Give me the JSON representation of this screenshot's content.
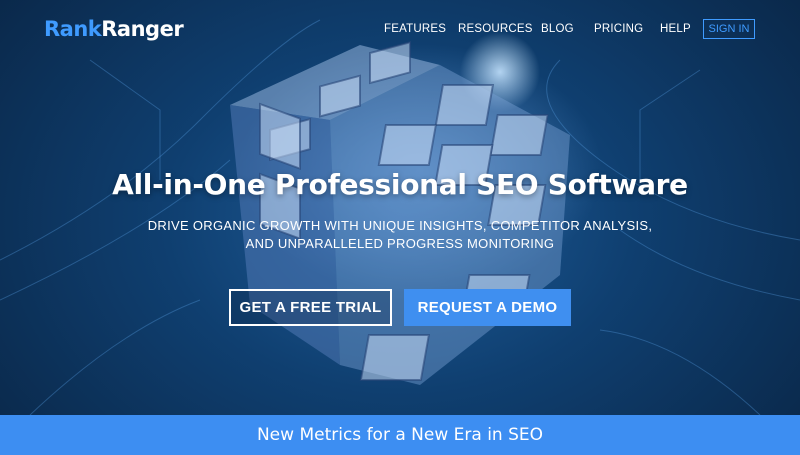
{
  "brand": {
    "part1": "Rank",
    "part2": "Ranger"
  },
  "nav": {
    "items": [
      "FEATURES",
      "RESOURCES",
      "BLOG",
      "PRICING",
      "HELP"
    ],
    "signin": "SIGN IN"
  },
  "hero": {
    "headline": "All-in-One Professional SEO Software",
    "subline1": "DRIVE ORGANIC GROWTH WITH UNIQUE INSIGHTS, COMPETITOR ANALYSIS,",
    "subline2": "AND UNPARALLELED PROGRESS MONITORING",
    "trial_label": "GET A FREE TRIAL",
    "demo_label": "REQUEST A DEMO"
  },
  "banner": {
    "text": "New Metrics for a New Era in SEO"
  },
  "colors": {
    "accent": "#3f9bff",
    "button": "#3f8ff0",
    "banner": "#3d8ef2",
    "background": "#0f3f70"
  }
}
